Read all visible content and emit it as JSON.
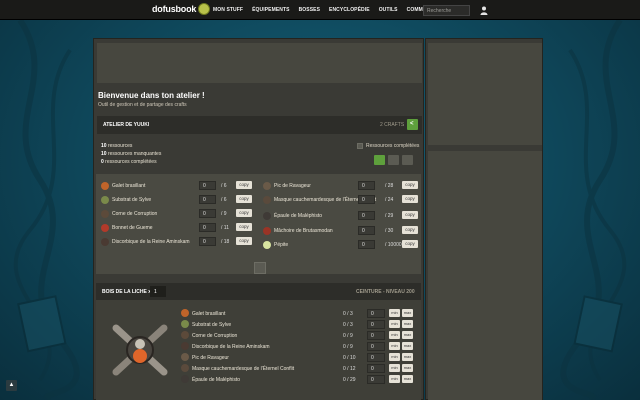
{
  "header": {
    "logo": "dofusbook",
    "nav": [
      "MON STUFF",
      "ÉQUIPEMENTS",
      "BOSSES",
      "ENCYCLOPÉDIE",
      "OUTILS",
      "COMMUNAUTÉ"
    ],
    "search_placeholder": "Recherche"
  },
  "page": {
    "welcome": "Bienvenue dans ton atelier !",
    "subtitle": "Outil de gestion et de partage des crafts"
  },
  "atelier": {
    "title": "ATELIER DE YUUKI",
    "count": "2 CRAFTS",
    "stats": [
      {
        "num": "10",
        "label": "ressources"
      },
      {
        "num": "10",
        "label": "ressources manquantes"
      },
      {
        "num": "0",
        "label": "ressources complétées"
      }
    ],
    "check_label": "Ressources complétées",
    "copy_label": "copy",
    "resources_left": [
      {
        "name": "Galet brasillant",
        "value": "0",
        "total": "/ 6",
        "icon": "galet-icon",
        "color": "#c0642a"
      },
      {
        "name": "Substrat de Sylve",
        "value": "0",
        "total": "/ 6",
        "icon": "substrat-icon",
        "color": "#7a8a4a"
      },
      {
        "name": "Corne de Corruption",
        "value": "0",
        "total": "/ 9",
        "icon": "corne-icon",
        "color": "#5c4a3a"
      },
      {
        "name": "Bonnet de Gueme",
        "value": "0",
        "total": "/ 11",
        "icon": "bonnet-icon",
        "color": "#b23a2a"
      },
      {
        "name": "Discorbique de la Reine Aminskam",
        "value": "0",
        "total": "/ 18",
        "icon": "discorbique-icon",
        "color": "#4a3a32"
      }
    ],
    "resources_right": [
      {
        "name": "Pic de Ravageur",
        "value": "0",
        "total": "/ 28",
        "icon": "pic-icon",
        "color": "#6a5a48"
      },
      {
        "name": "Masque cauchemardesque de l'Éternel Conflit",
        "value": "0",
        "total": "/ 24",
        "icon": "masque-icon",
        "color": "#5a4a3c"
      },
      {
        "name": "Épaule de Maléphisto",
        "value": "0",
        "total": "/ 29",
        "icon": "epaule-icon",
        "color": "#3f3a36"
      },
      {
        "name": "Mâchoire de Brutasmodan",
        "value": "0",
        "total": "/ 30",
        "icon": "machoire-icon",
        "color": "#9a3426"
      },
      {
        "name": "Pépite",
        "value": "0",
        "total": "/ 10000",
        "icon": "pepite-icon",
        "color": "#d8e4a0"
      }
    ]
  },
  "recipe": {
    "title": "BOIS DE LA LICHE x",
    "qty": "1",
    "level": "CEINTURE - NIVEAU 200",
    "min_label": "min",
    "max_label": "max",
    "ingredients": [
      {
        "name": "Galet brasillant",
        "frac": "0 / 3",
        "value": "0",
        "icon": "galet-icon",
        "color": "#c0642a"
      },
      {
        "name": "Substrat de Sylve",
        "frac": "0 / 3",
        "value": "0",
        "icon": "substrat-icon",
        "color": "#7a8a4a"
      },
      {
        "name": "Corne de Corruption",
        "frac": "0 / 9",
        "value": "0",
        "icon": "corne-icon",
        "color": "#5c4a3a"
      },
      {
        "name": "Discorbique de la Reine Aminskam",
        "frac": "0 / 9",
        "value": "0",
        "icon": "discorbique-icon",
        "color": "#4a3a32"
      },
      {
        "name": "Pic de Ravageur",
        "frac": "0 / 10",
        "value": "0",
        "icon": "pic-icon",
        "color": "#6a5a48"
      },
      {
        "name": "Masque cauchemardesque de l'Éternel Conflit",
        "frac": "0 / 12",
        "value": "0",
        "icon": "masque-icon",
        "color": "#5a4a3c"
      },
      {
        "name": "Épaule de Maléphisto",
        "frac": "0 / 29",
        "value": "0",
        "icon": "epaule-icon",
        "color": "#3f3a36"
      }
    ]
  }
}
